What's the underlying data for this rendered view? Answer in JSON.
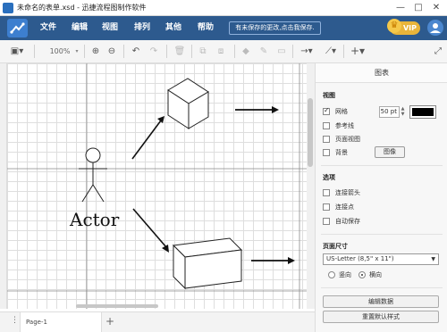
{
  "window": {
    "title": "未命名的表单.xsd - 迅捷流程图制作软件",
    "minimize": "—",
    "maximize": "□",
    "close": "✕"
  },
  "menu": {
    "items": [
      "文件",
      "编辑",
      "视图",
      "排列",
      "其他",
      "帮助"
    ],
    "unsaved_notice": "有未保存的更改,点击我保存.",
    "vip_label": "VIP"
  },
  "toolbar": {
    "zoom": "100%",
    "icons": [
      "panel-toggle-icon",
      "zoom-in-icon",
      "zoom-out-icon",
      "undo-icon",
      "redo-icon",
      "delete-icon",
      "to-front-icon",
      "to-back-icon",
      "fill-color-icon",
      "line-color-icon",
      "shadow-icon",
      "connection-icon",
      "waypoint-icon",
      "insert-icon"
    ]
  },
  "canvas": {
    "actor_label": "Actor"
  },
  "panel": {
    "title": "图表",
    "view_section": "视图",
    "grid_label": "网格",
    "grid_checked": true,
    "grid_size": "50 pt",
    "grid_color": "#000000",
    "guides_label": "参考线",
    "page_view_label": "页面视图",
    "background_label": "背景",
    "image_button": "图像",
    "options_section": "选项",
    "connection_arrows_label": "连接箭头",
    "connection_points_label": "连接点",
    "autosave_label": "自动保存",
    "page_size_section": "页面尺寸",
    "page_size_value": "US-Letter (8,5\" x 11\")",
    "portrait_label": "竖向",
    "landscape_label": "横向",
    "orientation_selected": "横向",
    "edit_data_button": "编辑数据",
    "reset_style_button": "重置默认样式"
  },
  "status": {
    "page_tab": "Page-1",
    "add_page": "+"
  }
}
